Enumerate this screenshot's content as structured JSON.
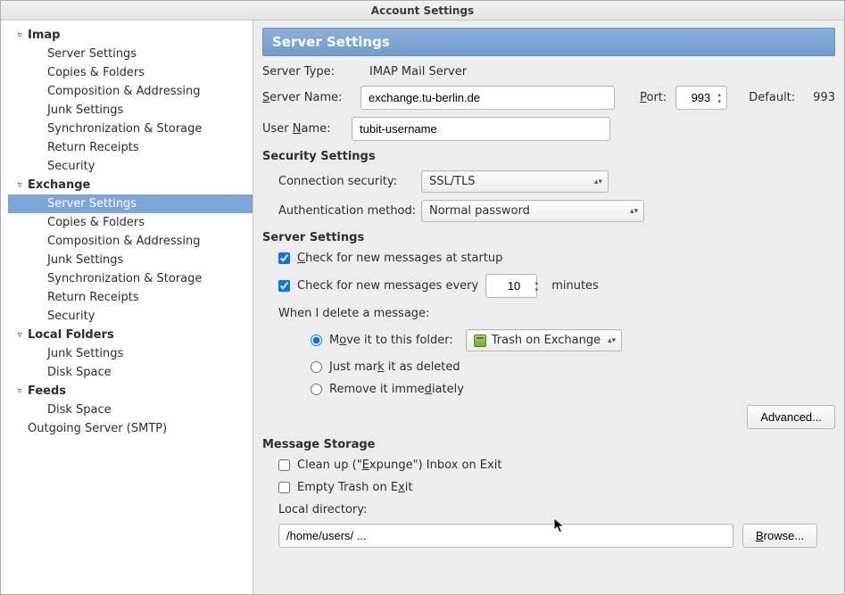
{
  "window": {
    "title": "Account Settings"
  },
  "sidebar": {
    "accounts": [
      {
        "name": "Imap",
        "items": [
          {
            "label": "Server Settings",
            "selected": false
          },
          {
            "label": "Copies & Folders",
            "selected": false
          },
          {
            "label": "Composition & Addressing",
            "selected": false
          },
          {
            "label": "Junk Settings",
            "selected": false
          },
          {
            "label": "Synchronization & Storage",
            "selected": false
          },
          {
            "label": "Return Receipts",
            "selected": false
          },
          {
            "label": "Security",
            "selected": false
          }
        ]
      },
      {
        "name": "Exchange",
        "items": [
          {
            "label": "Server Settings",
            "selected": true
          },
          {
            "label": "Copies & Folders",
            "selected": false
          },
          {
            "label": "Composition & Addressing",
            "selected": false
          },
          {
            "label": "Junk Settings",
            "selected": false
          },
          {
            "label": "Synchronization & Storage",
            "selected": false
          },
          {
            "label": "Return Receipts",
            "selected": false
          },
          {
            "label": "Security",
            "selected": false
          }
        ]
      },
      {
        "name": "Local Folders",
        "items": [
          {
            "label": "Junk Settings",
            "selected": false
          },
          {
            "label": "Disk Space",
            "selected": false
          }
        ]
      },
      {
        "name": "Feeds",
        "items": [
          {
            "label": "Disk Space",
            "selected": false
          }
        ]
      }
    ],
    "outgoing": "Outgoing Server (SMTP)"
  },
  "panel": {
    "header": "Server Settings",
    "server_type_label": "Server Type:",
    "server_type_value": "IMAP Mail Server",
    "server_name_label": "Server Name:",
    "server_name_value": "exchange.tu-berlin.de",
    "port_label": "Port:",
    "port_value": "993",
    "default_label": "Default:",
    "default_value": "993",
    "user_name_label": "User Name:",
    "user_name_value": "tubit-username",
    "security_heading": "Security Settings",
    "conn_security_label": "Connection security:",
    "conn_security_value": "SSL/TLS",
    "auth_method_label": "Authentication method:",
    "auth_method_value": "Normal password",
    "server_settings_heading": "Server Settings",
    "check_startup_label": "Check for new messages at startup",
    "check_every_prefix": "Check for new messages every",
    "check_every_value": "10",
    "check_every_suffix": "minutes",
    "delete_label": "When I delete a message:",
    "radio_move_label": "Move it to this folder:",
    "trash_folder_value": "Trash on Exchange",
    "radio_mark_label": "Just mark it as deleted",
    "radio_remove_label": "Remove it immediately",
    "advanced_label": "Advanced...",
    "storage_heading": "Message Storage",
    "cleanup_label": "Clean up (\"Expunge\") Inbox on Exit",
    "empty_trash_label": "Empty Trash on Exit",
    "local_dir_label": "Local directory:",
    "local_dir_value": "/home/users/ ...",
    "browse_label": "Browse..."
  }
}
